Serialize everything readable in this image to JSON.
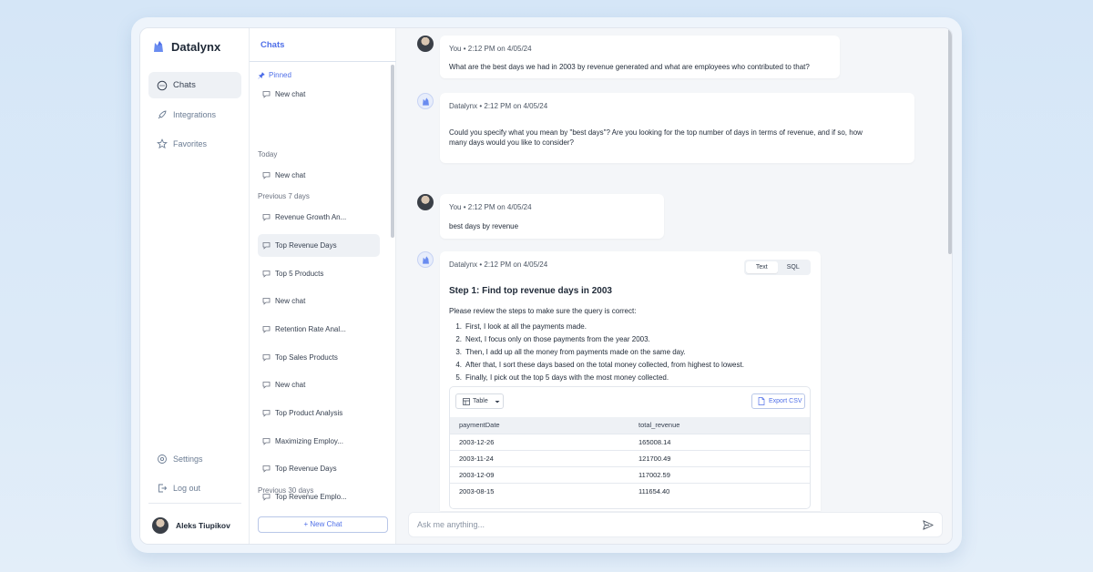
{
  "app": {
    "name": "Datalynx",
    "accent": "#4f6fe8"
  },
  "nav": {
    "items": [
      {
        "label": "Chats",
        "icon": "chat-bubble-icon",
        "active": true
      },
      {
        "label": "Integrations",
        "icon": "rocket-icon",
        "active": false
      },
      {
        "label": "Favorites",
        "icon": "star-icon",
        "active": false
      }
    ],
    "bottom": [
      {
        "label": "Settings",
        "icon": "gear-icon"
      },
      {
        "label": "Log out",
        "icon": "logout-icon"
      }
    ],
    "user_name": "Aleks Tiupikov"
  },
  "chats": {
    "title": "Chats",
    "pinned_label": "Pinned",
    "pinned": [
      "New chat"
    ],
    "today_label": "Today",
    "today": [
      "New chat"
    ],
    "prev7_label": "Previous 7 days",
    "prev7": [
      "Revenue Growth An...",
      "Top Revenue Days",
      "Top 5 Products",
      "New chat",
      "Retention Rate Anal...",
      "Top Sales Products",
      "New chat",
      "Top Product Analysis",
      "Maximizing Employ...",
      "Top Revenue Days",
      "Top Revenue Emplo..."
    ],
    "prev30_label": "Previous 30 days",
    "new_chat_button": "+ New Chat"
  },
  "messages": [
    {
      "author": "You",
      "meta": "You • 2:12 PM on 4/05/24",
      "text": "What are the best days we had in 2003 by revenue generated and what are employees who contributed to that?"
    },
    {
      "author": "Datalynx",
      "meta": "Datalynx • 2:12 PM on 4/05/24",
      "text_line1": "Could you specify what you mean by \"best days\"? Are you looking for the top number of days in terms of revenue, and if so, how",
      "text_line2": "many days would you like to consider?"
    },
    {
      "author": "You",
      "meta": "You • 2:12 PM on 4/05/24",
      "text": "best days by revenue"
    },
    {
      "author": "Datalynx",
      "meta": "Datalynx • 2:12 PM on 4/05/24",
      "toggle": {
        "text": "Text",
        "sql": "SQL",
        "selected": "Text"
      },
      "step_title": "Step 1: Find top revenue days in 2003",
      "intro": "Please review the steps to make sure the query is correct:",
      "steps": [
        "First, I look at all the payments made.",
        "Next, I focus only on those payments from the year 2003.",
        "Then, I add up all the money from payments made on the same day.",
        "After that, I sort these days based on the total money collected, from highest to lowest.",
        "Finally, I pick out the top 5 days with the most money collected."
      ],
      "table": {
        "view_label": "Table",
        "export_label": "Export CSV",
        "columns": [
          "paymentDate",
          "total_revenue"
        ],
        "rows": [
          [
            "2003-12-26",
            "165008.14"
          ],
          [
            "2003-11-24",
            "121700.49"
          ],
          [
            "2003-12-09",
            "117002.59"
          ],
          [
            "2003-08-15",
            "111654.40"
          ]
        ]
      }
    }
  ],
  "composer": {
    "placeholder": "Ask me anything..."
  }
}
